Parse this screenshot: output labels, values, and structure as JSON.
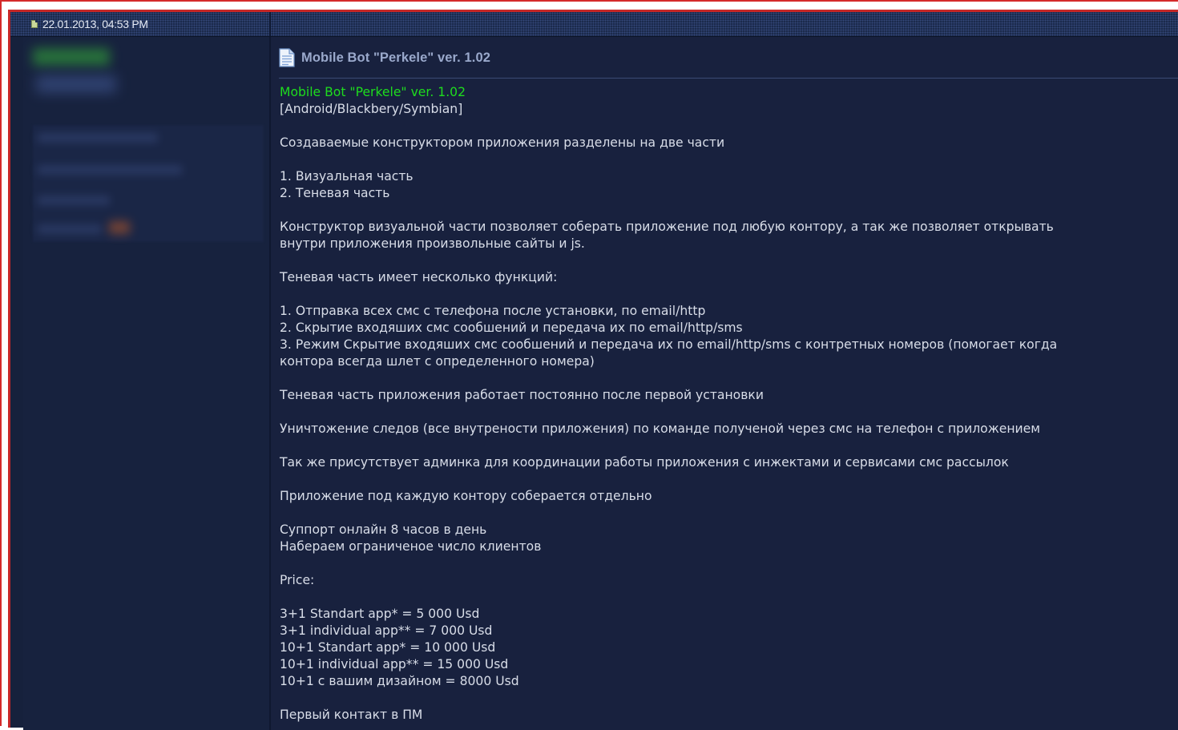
{
  "header": {
    "date": "22.01.2013, 04:53 PM"
  },
  "post": {
    "title": "Mobile Bot \"Perkele\" ver. 1.02",
    "body_lines": [
      "Mobile Bot \"Perkele\" ver. 1.02",
      "[Android/Blackbery/Symbian]",
      "",
      "Создаваемые конструктором приложения разделены на две части",
      "",
      "1. Визуальная часть",
      "2. Теневая часть",
      "",
      "Конструктор визуальной части позволяет соберать приложение под любую контору, а так же позволяет открывать",
      "внутри приложения произвольные сайты и js.",
      "",
      "Теневая часть имеет несколько функций:",
      "",
      "1. Отправка всех смс с телефона после установки, по email/http",
      "2. Скрытие входяших смс сообшений и передача их по email/http/sms",
      "3. Режим Скрытие входяших смс сообшений и передача их по email/http/sms с контретных номеров (помогает когда",
      "контора всегда шлет с определенного номера)",
      "",
      "Теневая часть приложения работает постоянно после первой установки",
      "",
      "Уничтожение следов (все внутрености приложения) по команде полученой через смс на телефон с приложением",
      "",
      "Так же присутствует админка для координации работы приложения с инжектами и сервисами смс рассылок",
      "",
      "Приложение под каждую контору соберается отдельно",
      "",
      "Суппорт онлайн 8 часов в день",
      "Набераем ограниченое число клиентов",
      "",
      "Price:",
      "",
      "3+1 Standart app* = 5 000 Usd",
      "3+1 individual app** = 7 000 Usd",
      "10+1 Standart app* = 10 000 Usd",
      "10+1 individual app** = 15 000 Usd",
      "10+1 с вашим дизайном = 8000 Usd",
      "",
      "Первый контакт в ПМ"
    ]
  },
  "colors": {
    "accent_green": "#1edc1e",
    "border_red": "#c62828",
    "background": "#18213e"
  },
  "icons": {
    "post_status": "post-status-icon",
    "document": "document-icon"
  }
}
